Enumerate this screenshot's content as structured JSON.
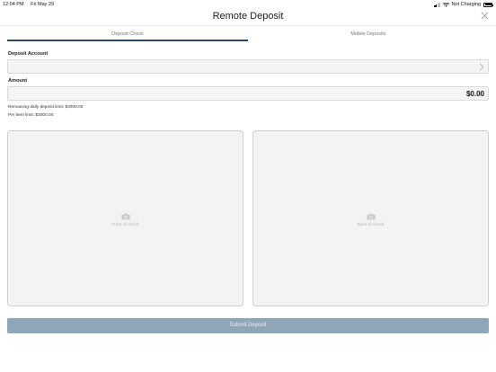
{
  "status_bar": {
    "time": "12:04 PM",
    "date": "Fri May 29",
    "charging_text": "Not Charging",
    "icons": [
      "signal-icon",
      "wifi-icon",
      "battery-icon"
    ]
  },
  "header": {
    "title": "Remote Deposit",
    "close_icon": "close-icon"
  },
  "tabs": [
    {
      "label": "Deposit Check",
      "active": true
    },
    {
      "label": "Mobile Deposits",
      "active": false
    }
  ],
  "form": {
    "deposit_account_label": "Deposit Account",
    "deposit_account_value": "",
    "amount_label": "Amount",
    "amount_value": "$0.00",
    "remaining_limit": "Remaining daily deposit limit: $3000.00",
    "per_item_limit": "Per item limit: $3000.00"
  },
  "check_images": {
    "front_caption": "Front of check",
    "back_caption": "Back of check",
    "icon": "camera-icon"
  },
  "submit_label": "Submit Deposit",
  "colors": {
    "accent": "#2e4a62",
    "submit_bg": "#8fa6b8",
    "panel_bg": "#f3f3f3"
  }
}
